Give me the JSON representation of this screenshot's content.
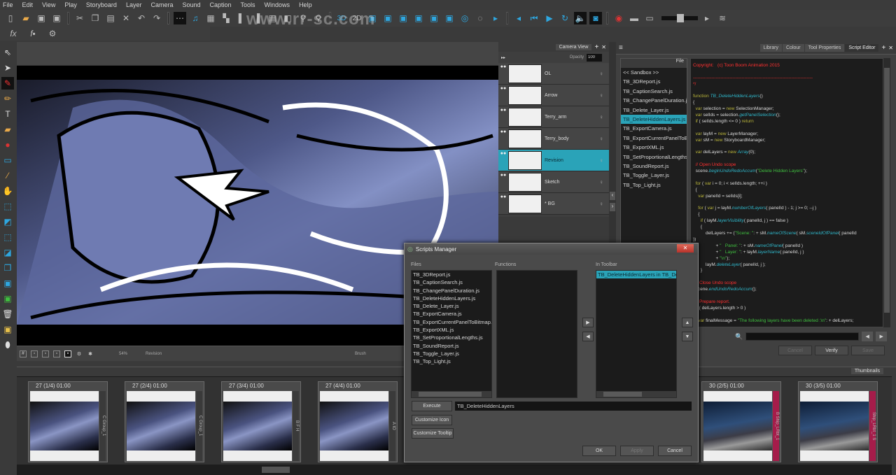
{
  "menu": [
    "File",
    "Edit",
    "View",
    "Play",
    "Storyboard",
    "Layer",
    "Camera",
    "Sound",
    "Caption",
    "Tools",
    "Windows",
    "Help"
  ],
  "toolbar": {
    "icons_left": [
      "new-icon",
      "open-icon",
      "save-icon",
      "save-as-icon",
      "cut-icon",
      "copy-icon",
      "paste-icon",
      "delete-icon",
      "undo-icon",
      "redo-icon",
      "grid-icon",
      "music-icon",
      "view-grid-icon",
      "view-two-icon",
      "view-side-icon",
      "view-right-icon",
      "view-table-icon"
    ],
    "icons_mid": [
      "layout-icon",
      "zoom-in-icon",
      "zoom-out-icon",
      "3d-icon",
      "2d-icon"
    ],
    "icons_play": [
      "prev-icon",
      "step-back-icon",
      "play-icon",
      "loop-icon",
      "sound-icon",
      "camera-icon"
    ],
    "labels_3d": "3D",
    "labels_2d": "2D",
    "watermark": "www.rr-sc.com",
    "fx_icons": [
      "fx-icon",
      "fx-lock-icon",
      "gear-icon"
    ]
  },
  "tools": [
    "select-icon",
    "contour-icon",
    "brush-icon",
    "pencil-icon",
    "text-icon",
    "paint-icon",
    "paint-bucket-icon",
    "rectangle-icon",
    "eyedropper-icon",
    "hand-icon",
    "transform-icon",
    "layer-transform-icon",
    "camera-frame-icon",
    "cut-panel-icon",
    "duplicate-panel-icon",
    "import-icon",
    "export-icon",
    "trash-icon",
    "lock-icon",
    "pin-icon"
  ],
  "stage_bar": {
    "zoom": "54%",
    "layer": "Revision",
    "tool": "Brush"
  },
  "layers_panel": {
    "tab": "Camera View",
    "opacity_label": "Opacity",
    "opacity_value": "100",
    "layers": [
      {
        "name": "OL",
        "selected": false
      },
      {
        "name": "Arrow",
        "selected": false
      },
      {
        "name": "Terry_arm",
        "selected": false
      },
      {
        "name": "Terry_body",
        "selected": false
      },
      {
        "name": "Revision",
        "selected": true
      },
      {
        "name": "Sketch",
        "selected": false
      },
      {
        "name": "* BG",
        "selected": false
      }
    ]
  },
  "right_panel": {
    "tabs": [
      "Library",
      "Colour",
      "Tool Properties",
      "Script Editor"
    ],
    "active_tab": "Script Editor",
    "file_header": "File",
    "files": [
      "<< Sandbox >>",
      "TB_3DReport.js",
      "TB_CaptionSearch.js",
      "TB_ChangePanelDuration.js",
      "TB_Delete_Layer.js",
      "TB_DeleteHiddenLayers.js",
      "TB_ExportCamera.js",
      "TB_ExportCurrentPanelToBitmap.js",
      "TB_ExportXML.js",
      "TB_SetProportionalLengths.js",
      "TB_SoundReport.js",
      "TB_Toggle_Layer.js",
      "TB_Top_Light.js"
    ],
    "selected_file": "TB_DeleteHiddenLayers.js",
    "buttons": {
      "cancel": "Cancel",
      "verify": "Verify",
      "save": "Save"
    }
  },
  "code_lines": [
    [
      [
        "red",
        "Copyright:   (c) Toon Boom Animation 2015"
      ]
    ],
    [
      [
        "",
        ""
      ]
    ],
    [
      [
        "red",
        "-------------------------------------------------------------------------------"
      ]
    ],
    [
      [
        "red",
        "*/"
      ]
    ],
    [
      [
        "",
        ""
      ]
    ],
    [
      [
        "kw",
        "function "
      ],
      [
        "fn",
        "TB_DeleteHiddenLayers"
      ],
      [
        "",
        "()"
      ]
    ],
    [
      [
        "",
        "{"
      ]
    ],
    [
      [
        "kw",
        "  var "
      ],
      [
        "",
        "selection = "
      ],
      [
        "kw",
        "new "
      ],
      [
        "",
        "SelectionManager;"
      ]
    ],
    [
      [
        "kw",
        "  var "
      ],
      [
        "",
        "selIds = selection."
      ],
      [
        "fn",
        "getPanelSelection"
      ],
      [
        "",
        "();"
      ]
    ],
    [
      [
        "kw",
        "  if "
      ],
      [
        "",
        "( selIds.length <= 0 ) "
      ],
      [
        "kw",
        "return"
      ],
      [
        ";",
        ""
      ]
    ],
    [
      [
        "",
        ""
      ]
    ],
    [
      [
        "kw",
        "  var "
      ],
      [
        "",
        "layM = "
      ],
      [
        "kw",
        "new "
      ],
      [
        "",
        "LayerManager;"
      ]
    ],
    [
      [
        "kw",
        "  var "
      ],
      [
        "",
        "sM = "
      ],
      [
        "kw",
        "new "
      ],
      [
        "",
        "StoryboardManager;"
      ]
    ],
    [
      [
        "",
        ""
      ]
    ],
    [
      [
        "kw",
        "  var "
      ],
      [
        "",
        "delLayers = "
      ],
      [
        "kw",
        "new "
      ],
      [
        "fn",
        "Array"
      ],
      [
        "",
        "(0);"
      ]
    ],
    [
      [
        "",
        ""
      ]
    ],
    [
      [
        "red",
        "  // Open Undo scope"
      ]
    ],
    [
      [
        "",
        "  scene."
      ],
      [
        "fn",
        "beginUndoRedoAccum"
      ],
      [
        "",
        "("
      ],
      [
        "str",
        "\"Delete Hidden Layers\""
      ],
      [
        "",
        ");"
      ]
    ],
    [
      [
        "",
        ""
      ]
    ],
    [
      [
        "kw",
        "  for "
      ],
      [
        "",
        "( "
      ],
      [
        "kw",
        "var "
      ],
      [
        "",
        "i = 0; i < selIds.length; ++i )"
      ]
    ],
    [
      [
        "",
        "  {"
      ]
    ],
    [
      [
        "kw",
        "    var "
      ],
      [
        "",
        "panelId = selIds[i];"
      ]
    ],
    [
      [
        "",
        ""
      ]
    ],
    [
      [
        "kw",
        "    for "
      ],
      [
        "",
        "( "
      ],
      [
        "kw",
        "var "
      ],
      [
        "",
        "j = layM."
      ],
      [
        "fn",
        "numberOfLayers"
      ],
      [
        "",
        "( panelId ) - 1; j >= 0; --j )"
      ]
    ],
    [
      [
        "",
        "    {"
      ]
    ],
    [
      [
        "kw",
        "      if "
      ],
      [
        "",
        "( layM."
      ],
      [
        "fn",
        "layerVisibility"
      ],
      [
        "",
        "( panelId, j ) == false )"
      ]
    ],
    [
      [
        "",
        "      {"
      ]
    ],
    [
      [
        "",
        "          delLayers += ("
      ],
      [
        "str",
        "\"Scene: \""
      ],
      [
        "",
        ": + sM."
      ],
      [
        "fn",
        "nameOfScene"
      ],
      [
        "",
        "( sM."
      ],
      [
        "fn",
        "sceneIdOfPanel"
      ],
      [
        "",
        "( panelId"
      ]
    ],
    [
      [
        "",
        "))"
      ]
    ],
    [
      [
        "",
        "                  + "
      ],
      [
        "str",
        "\"   Panel: \""
      ],
      [
        "",
        ": + sM."
      ],
      [
        "fn",
        "nameOfPanel"
      ],
      [
        "",
        "( panelId )"
      ]
    ],
    [
      [
        "",
        "                  + "
      ],
      [
        "str",
        "\"   Layer: \""
      ],
      [
        "",
        ": + layM."
      ],
      [
        "fn",
        "layerName"
      ],
      [
        "",
        "( panelId, j )"
      ]
    ],
    [
      [
        "",
        "                  + "
      ],
      [
        "str",
        "\"\\n\""
      ],
      [
        "",
        ");"
      ]
    ],
    [
      [
        "",
        "          layM."
      ],
      [
        "fn",
        "deleteLayer"
      ],
      [
        "",
        "( panelId, j );"
      ]
    ],
    [
      [
        "",
        "      }"
      ]
    ],
    [
      [
        "",
        ""
      ]
    ],
    [
      [
        "red",
        "  // Close Undo scope"
      ]
    ],
    [
      [
        "",
        "  scene."
      ],
      [
        "fn",
        "endUndoRedoAccum"
      ],
      [
        "",
        "();"
      ]
    ],
    [
      [
        "",
        ""
      ]
    ],
    [
      [
        "red",
        "  // Prepare report."
      ]
    ],
    [
      [
        "kw",
        "  if "
      ],
      [
        "",
        "( delLayers.length > 0 )"
      ]
    ],
    [
      [
        "",
        ""
      ]
    ],
    [
      [
        "kw",
        "    var "
      ],
      [
        "",
        "finalMessage = "
      ],
      [
        "str",
        "\"The following layers have been deleted :\\n\""
      ],
      [
        "",
        ": + delLayers;"
      ]
    ]
  ],
  "thumbnails": {
    "tab": "Thumbnails",
    "panels": [
      {
        "label": "27 (1/4) 01:00",
        "strip": "C  Group_1",
        "style": "sketch"
      },
      {
        "label": "27 (2/4) 01:00",
        "strip": "C  Group_1",
        "style": "sketch"
      },
      {
        "label": "27 (3/4) 01:00",
        "strip": "B  F  H",
        "style": "sketch"
      },
      {
        "label": "27 (4/4) 01:00",
        "strip": "A  IO",
        "style": "sketch"
      },
      {
        "label": "30 (2/5) 01:00",
        "strip": "B  Ship_LRbt_1",
        "style": "scifi"
      },
      {
        "label": "30 (3/5) 01:00",
        "strip": "Ship_LRbt_1  S",
        "style": "scifi"
      }
    ]
  },
  "dialog": {
    "title": "Scripts Manager",
    "files_label": "Files",
    "functions_label": "Functions",
    "toolbar_label": "In Toolbar",
    "files": [
      "TB_3DReport.js",
      "TB_CaptionSearch.js",
      "TB_ChangePanelDuration.js",
      "TB_DeleteHiddenLayers.js",
      "TB_Delete_Layer.js",
      "TB_ExportCamera.js",
      "TB_ExportCurrentPanelToBitmap.js",
      "TB_ExportXML.js",
      "TB_SetProportionalLengths.js",
      "TB_SoundReport.js",
      "TB_Toggle_Layer.js",
      "TB_Top_Light.js"
    ],
    "toolbar_items": [
      "TB_DeleteHiddenLayers in TB_DeleteHiddenLayers.js"
    ],
    "execute_label": "Execute",
    "execute_value": "TB_DeleteHiddenLayers",
    "customize_icon": "Customize Icon",
    "customize_tooltip": "Customize Tooltip",
    "ok": "OK",
    "apply": "Apply",
    "cancel": "Cancel"
  },
  "colors": {
    "accent": "#2aa3b8",
    "keyword": "#b9b43a",
    "function": "#2fb6c9",
    "string": "#3fbf3f",
    "comment": "#ff3030"
  }
}
